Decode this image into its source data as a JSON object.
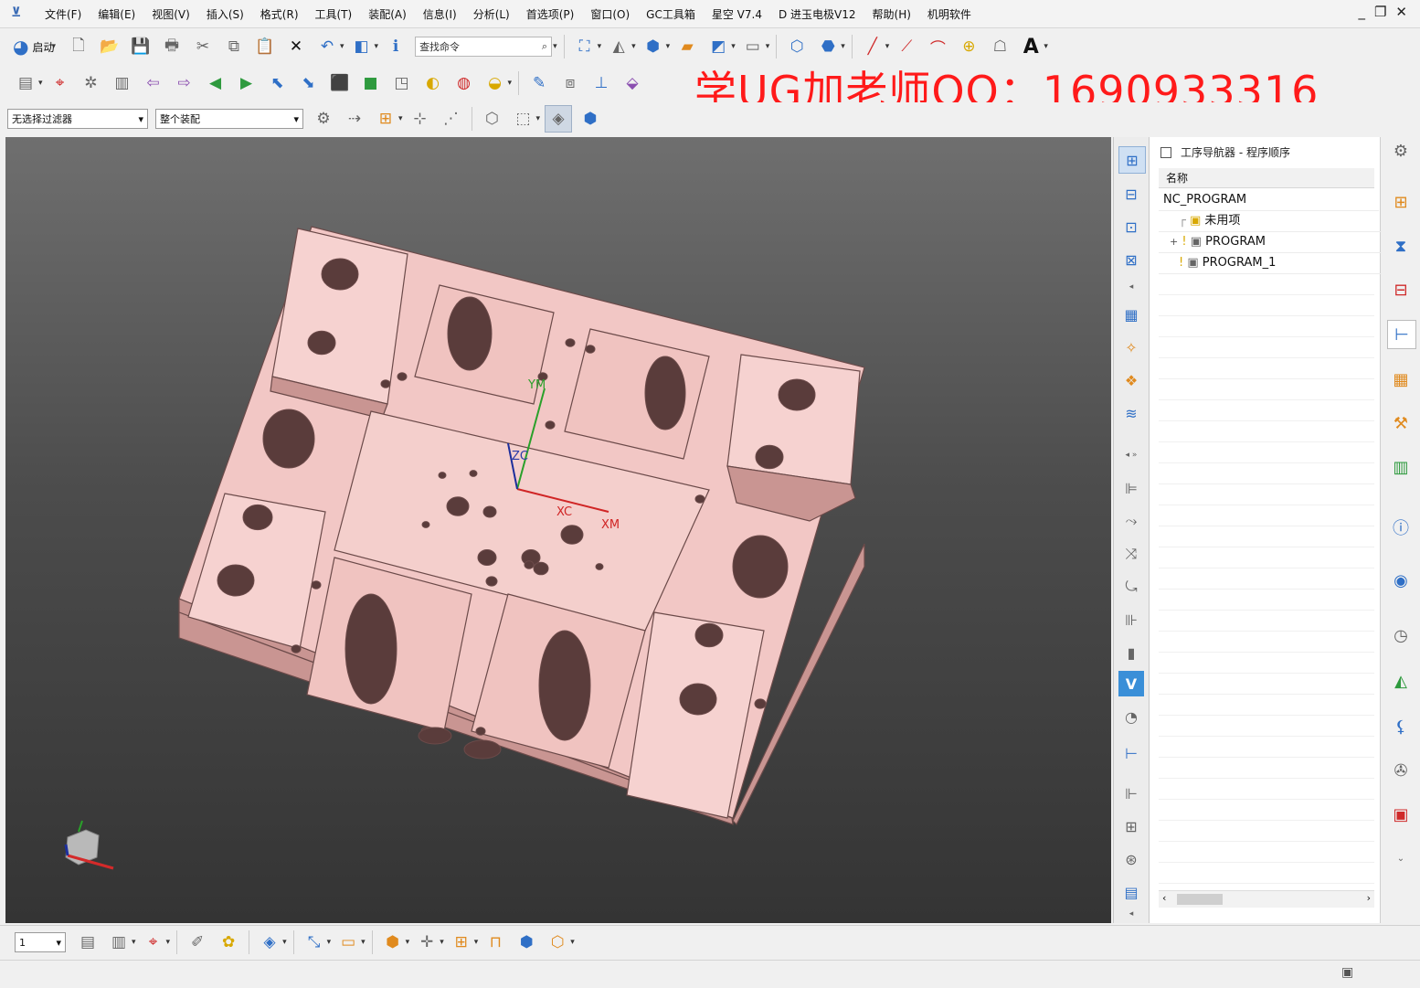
{
  "app": {
    "menus": [
      "文件(F)",
      "编辑(E)",
      "视图(V)",
      "插入(S)",
      "格式(R)",
      "工具(T)",
      "装配(A)",
      "信息(I)",
      "分析(L)",
      "首选项(P)",
      "窗口(O)",
      "GC工具箱",
      "星空 V7.4",
      "D 进玉电极V12",
      "帮助(H)",
      "机明软件"
    ]
  },
  "toolbar": {
    "start_label": "启动",
    "search_placeholder": "查找命令",
    "selection_filter": "无选择过滤器",
    "assembly_scope": "整个装配",
    "layer_value": "1"
  },
  "watermark": "学UG加老师QQ：1690933316",
  "navigator": {
    "title": "工序导航器 - 程序顺序",
    "column_name": "名称",
    "root": "NC_PROGRAM",
    "items": [
      {
        "label": "未用项"
      },
      {
        "label": "PROGRAM"
      },
      {
        "label": "PROGRAM_1"
      }
    ]
  },
  "viewport": {
    "axis_labels": {
      "y": "YM",
      "z": "ZC",
      "x1": "XC",
      "x2": "XM"
    },
    "part_color": "#f2c7c5",
    "part_side_color": "#c99592",
    "part_edge_color": "#6b4a49"
  },
  "colors": {
    "watermark": "#ff1a1a",
    "accent_blue": "#2f6fc6"
  }
}
